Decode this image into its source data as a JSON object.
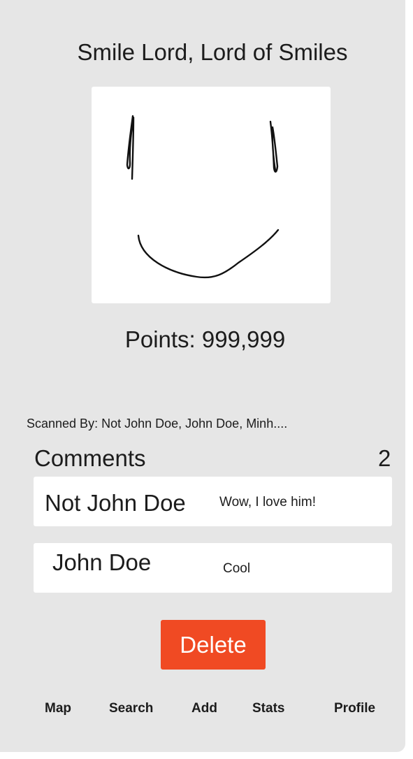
{
  "smile": {
    "title": "Smile Lord, Lord of Smiles",
    "points_text": "Points: 999,999",
    "image_icon": "smile-drawing-icon"
  },
  "scanned_by": {
    "text": "Scanned By: Not John Doe, John Doe, Minh...."
  },
  "comments": {
    "header": "Comments",
    "count": "2",
    "items": [
      {
        "author": "Not John Doe",
        "body": "Wow, I love him!"
      },
      {
        "author": "John Doe",
        "body": "Cool"
      }
    ]
  },
  "actions": {
    "delete_label": "Delete",
    "delete_color": "#f04a23"
  },
  "nav": {
    "items": [
      {
        "label": "Map"
      },
      {
        "label": "Search"
      },
      {
        "label": "Add"
      },
      {
        "label": "Stats"
      },
      {
        "label": "Profile"
      }
    ]
  },
  "colors": {
    "background": "#e6e6e6",
    "card": "#ffffff",
    "text": "#1c1c1c"
  }
}
